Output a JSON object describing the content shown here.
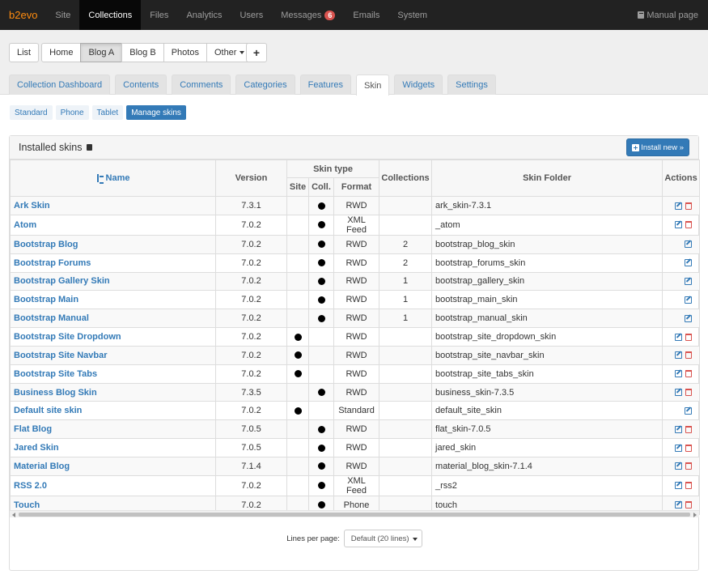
{
  "topbar": {
    "brand": "b2evo",
    "items": [
      {
        "label": "Site",
        "name": "nav-site"
      },
      {
        "label": "Collections",
        "name": "nav-collections",
        "active": true
      },
      {
        "label": "Files",
        "name": "nav-files"
      },
      {
        "label": "Analytics",
        "name": "nav-analytics"
      },
      {
        "label": "Users",
        "name": "nav-users"
      },
      {
        "label": "Messages",
        "name": "nav-messages"
      },
      {
        "label": "Emails",
        "name": "nav-emails"
      },
      {
        "label": "System",
        "name": "nav-system"
      }
    ],
    "messages_badge": "6",
    "manual": "Manual page"
  },
  "collections": {
    "buttons": [
      "List",
      "Home",
      "Blog A",
      "Blog B",
      "Photos",
      "Other"
    ],
    "active": "Blog A",
    "add_label": "+"
  },
  "tabs": [
    "Collection Dashboard",
    "Contents",
    "Comments",
    "Categories",
    "Features",
    "Skin",
    "Widgets",
    "Settings"
  ],
  "active_tab": "Skin",
  "subtabs": [
    "Standard",
    "Phone",
    "Tablet",
    "Manage skins"
  ],
  "active_subtab": "Manage skins",
  "panel": {
    "title": "Installed skins",
    "install_label": "Install new »"
  },
  "table": {
    "headers": {
      "name": "Name",
      "version": "Version",
      "skin_type": "Skin type",
      "site": "Site",
      "coll": "Coll.",
      "format": "Format",
      "collections": "Collections",
      "folder": "Skin Folder",
      "actions": "Actions"
    },
    "rows": [
      {
        "name": "Ark Skin",
        "version": "7.3.1",
        "site": false,
        "coll": true,
        "format": "RWD",
        "collections": "",
        "folder": "ark_skin-7.3.1",
        "deletable": true
      },
      {
        "name": "Atom",
        "version": "7.0.2",
        "site": false,
        "coll": true,
        "format": "XML Feed",
        "collections": "",
        "folder": "_atom",
        "deletable": true
      },
      {
        "name": "Bootstrap Blog",
        "version": "7.0.2",
        "site": false,
        "coll": true,
        "format": "RWD",
        "collections": "2",
        "folder": "bootstrap_blog_skin",
        "deletable": false
      },
      {
        "name": "Bootstrap Forums",
        "version": "7.0.2",
        "site": false,
        "coll": true,
        "format": "RWD",
        "collections": "2",
        "folder": "bootstrap_forums_skin",
        "deletable": false
      },
      {
        "name": "Bootstrap Gallery Skin",
        "version": "7.0.2",
        "site": false,
        "coll": true,
        "format": "RWD",
        "collections": "1",
        "folder": "bootstrap_gallery_skin",
        "deletable": false
      },
      {
        "name": "Bootstrap Main",
        "version": "7.0.2",
        "site": false,
        "coll": true,
        "format": "RWD",
        "collections": "1",
        "folder": "bootstrap_main_skin",
        "deletable": false
      },
      {
        "name": "Bootstrap Manual",
        "version": "7.0.2",
        "site": false,
        "coll": true,
        "format": "RWD",
        "collections": "1",
        "folder": "bootstrap_manual_skin",
        "deletable": false
      },
      {
        "name": "Bootstrap Site Dropdown",
        "version": "7.0.2",
        "site": true,
        "coll": false,
        "format": "RWD",
        "collections": "",
        "folder": "bootstrap_site_dropdown_skin",
        "deletable": true
      },
      {
        "name": "Bootstrap Site Navbar",
        "version": "7.0.2",
        "site": true,
        "coll": false,
        "format": "RWD",
        "collections": "",
        "folder": "bootstrap_site_navbar_skin",
        "deletable": true
      },
      {
        "name": "Bootstrap Site Tabs",
        "version": "7.0.2",
        "site": true,
        "coll": false,
        "format": "RWD",
        "collections": "",
        "folder": "bootstrap_site_tabs_skin",
        "deletable": true
      },
      {
        "name": "Business Blog Skin",
        "version": "7.3.5",
        "site": false,
        "coll": true,
        "format": "RWD",
        "collections": "",
        "folder": "business_skin-7.3.5",
        "deletable": true
      },
      {
        "name": "Default site skin",
        "version": "7.0.2",
        "site": true,
        "coll": false,
        "format": "Standard",
        "collections": "",
        "folder": "default_site_skin",
        "deletable": false
      },
      {
        "name": "Flat Blog",
        "version": "7.0.5",
        "site": false,
        "coll": true,
        "format": "RWD",
        "collections": "",
        "folder": "flat_skin-7.0.5",
        "deletable": true
      },
      {
        "name": "Jared Skin",
        "version": "7.0.5",
        "site": false,
        "coll": true,
        "format": "RWD",
        "collections": "",
        "folder": "jared_skin",
        "deletable": true
      },
      {
        "name": "Material Blog",
        "version": "7.1.4",
        "site": false,
        "coll": true,
        "format": "RWD",
        "collections": "",
        "folder": "material_blog_skin-7.1.4",
        "deletable": true
      },
      {
        "name": "RSS 2.0",
        "version": "7.0.2",
        "site": false,
        "coll": true,
        "format": "XML Feed",
        "collections": "",
        "folder": "_rss2",
        "deletable": true
      },
      {
        "name": "Touch",
        "version": "7.0.2",
        "site": false,
        "coll": true,
        "format": "Phone",
        "collections": "",
        "folder": "touch",
        "deletable": true
      }
    ]
  },
  "pager": {
    "label": "Lines per page:",
    "value": "Default (20 lines)"
  }
}
